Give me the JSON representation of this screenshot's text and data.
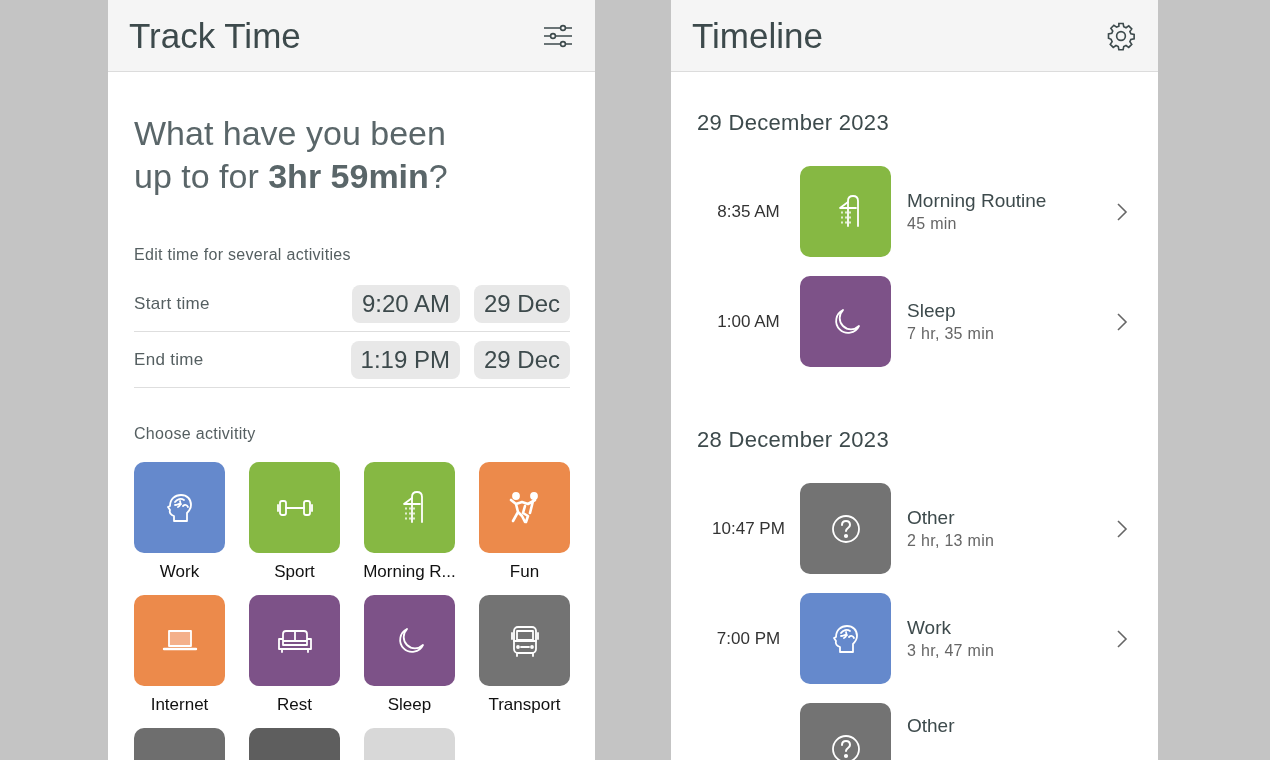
{
  "track_panel": {
    "title": "Track Time",
    "question": "What have you been\nup to for **3hr 59min**?",
    "edit_label": "Edit time for several activities",
    "time_rows": [
      {
        "label": "Start time",
        "time": "9:20 AM",
        "date": "29 Dec"
      },
      {
        "label": "End time",
        "time": "1:19 PM",
        "date": "29 Dec"
      }
    ],
    "choose_label": "Choose activitity",
    "activities": [
      {
        "label": "Work",
        "kind": "brain",
        "color": "#6589cc"
      },
      {
        "label": "Sport",
        "kind": "dumbbell",
        "color": "#86b843"
      },
      {
        "label": "Morning R...",
        "kind": "shower",
        "color": "#86b843"
      },
      {
        "label": "Fun",
        "kind": "dancers",
        "color": "#ec8a4b"
      },
      {
        "label": "Internet",
        "kind": "laptop",
        "color": "#ec8a4b"
      },
      {
        "label": "Rest",
        "kind": "sofa",
        "color": "#7d5288"
      },
      {
        "label": "Sleep",
        "kind": "moon",
        "color": "#7d5288"
      },
      {
        "label": "Transport",
        "kind": "bus",
        "color": "#737373"
      },
      {
        "kind": "blank",
        "color": "#6e6e6e"
      },
      {
        "kind": "blank",
        "color": "#5e5e5e"
      },
      {
        "kind": "blank",
        "color": "#d8d8d8"
      }
    ]
  },
  "timeline_panel": {
    "title": "Timeline",
    "days": [
      {
        "date": "29 December 2023",
        "entries": [
          {
            "time": "8:35 AM",
            "name": "Morning Routine",
            "duration": "45 min",
            "kind": "shower",
            "color": "#86b843"
          },
          {
            "time": "1:00 AM",
            "name": "Sleep",
            "duration": "7 hr, 35 min",
            "kind": "moon",
            "color": "#7d5288"
          }
        ]
      },
      {
        "date": "28 December 2023",
        "entries": [
          {
            "time": "10:47 PM",
            "name": "Other",
            "duration": "2 hr, 13 min",
            "kind": "question",
            "color": "#737373"
          },
          {
            "time": "7:00 PM",
            "name": "Work",
            "duration": "3 hr, 47 min",
            "kind": "brain",
            "color": "#6589cc"
          },
          {
            "name": "Other",
            "kind": "question",
            "color": "#737373"
          }
        ]
      }
    ]
  }
}
